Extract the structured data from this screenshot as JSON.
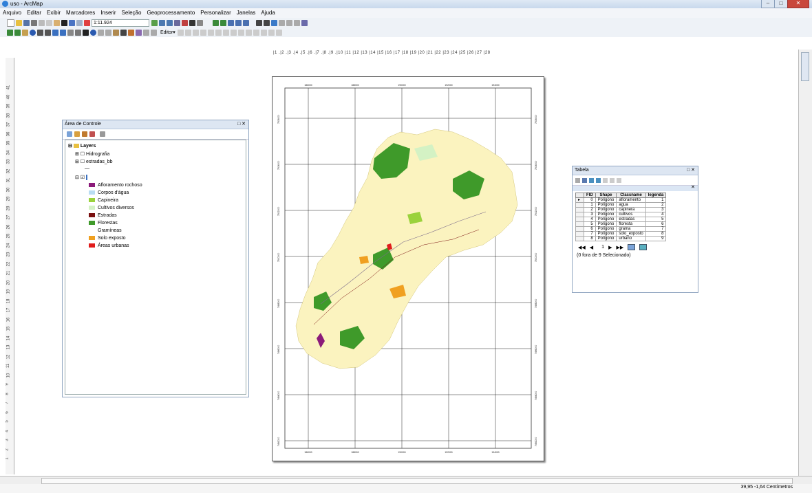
{
  "window": {
    "title": "uso - ArcMap"
  },
  "menu": [
    "Arquivo",
    "Editar",
    "Exibir",
    "Marcadores",
    "Inserir",
    "Seleção",
    "Geoprocessamento",
    "Personalizar",
    "Janelas",
    "Ajuda"
  ],
  "toolbar": {
    "scale": "1:11.924",
    "editor_label": "Editor▾"
  },
  "page_ruler": "|1 .|2 .|3 .|4 .|5 .|6 .|7 .|8 .|9 .|10 |11 |12 |13 |14 |15 |16 |17 |18 |19 |20 |21 |22 |23 |24 |25 |26 |27 |28",
  "vertical_ruler": [
    "41",
    "40",
    "39",
    "38",
    "37",
    "36",
    "35",
    "34",
    "33",
    "32",
    "31",
    "30",
    "29",
    "28",
    "27",
    "26",
    "25",
    "24",
    "23",
    "22",
    "21",
    "20",
    "19",
    "18",
    "17",
    "16",
    "15",
    "14",
    "13",
    "12",
    "11",
    "10",
    "9",
    "8",
    "7",
    "6",
    "5",
    "4",
    "3",
    "2",
    "1"
  ],
  "toc": {
    "title": "Área de Controle",
    "layers_label": "Layers",
    "layer_items": [
      "Hidrografia",
      "estradas_bb"
    ],
    "legend": [
      {
        "label": "Afloramento rochoso",
        "color": "#8b1a7a"
      },
      {
        "label": "Corpos d'água",
        "color": "#b9dcf2"
      },
      {
        "label": "Capineira",
        "color": "#9ad23c"
      },
      {
        "label": "Cultivos diversos",
        "color": "#d4f2c4"
      },
      {
        "label": "Estradas",
        "color": "#7a1010"
      },
      {
        "label": "Florestas",
        "color": "#3f9a2a"
      },
      {
        "label": "Gramíneas",
        "color": "#ffffff"
      },
      {
        "label": "Solo exposto",
        "color": "#f0a020"
      },
      {
        "label": "Áreas urbanas",
        "color": "#e01c1c"
      }
    ]
  },
  "map": {
    "top_coords": [
      "186000",
      "188000",
      "190000",
      "192000",
      "194000"
    ],
    "bottom_coords": [
      "186000",
      "188000",
      "190000",
      "192000",
      "194000"
    ],
    "side_coords": [
      "7506000",
      "7504000",
      "7502000",
      "7500000",
      "7498000",
      "7496000",
      "7494000",
      "7492000"
    ]
  },
  "tabela": {
    "title": "Tabela",
    "columns": [
      "FID",
      "Shape",
      "Classname",
      "legenda"
    ],
    "rows": [
      [
        "0",
        "Polígono",
        "afloramento",
        "1"
      ],
      [
        "1",
        "Polígono",
        "agua",
        "2"
      ],
      [
        "2",
        "Polígono",
        "capinera",
        "3"
      ],
      [
        "3",
        "Polígono",
        "cultivos",
        "4"
      ],
      [
        "4",
        "Polígono",
        "estradas",
        "5"
      ],
      [
        "5",
        "Polígono",
        "floresta",
        "6"
      ],
      [
        "6",
        "Polígono",
        "grama",
        "7"
      ],
      [
        "7",
        "Polígono",
        "solo_exposto",
        "8"
      ],
      [
        "8",
        "Polígono",
        "urbano",
        "9"
      ]
    ],
    "current_record": "1",
    "selection_info": "(0 fora de 9 Selecionado)"
  },
  "status": {
    "coordinates": "39,95  -1,64 Centímetros"
  }
}
